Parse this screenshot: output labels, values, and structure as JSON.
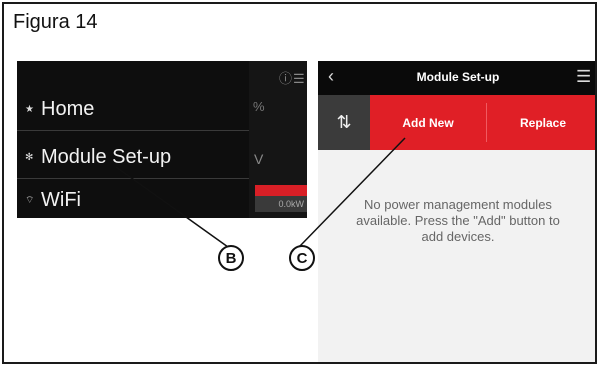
{
  "figure": {
    "title": "Figura 14"
  },
  "left_screen": {
    "menu": [
      {
        "icon": "home-icon",
        "glyph": "★",
        "label": "Home"
      },
      {
        "icon": "gear-icon",
        "glyph": "✻",
        "label": "Module Set-up"
      },
      {
        "icon": "wifi-icon",
        "glyph": "⌔",
        "label": "WiFi"
      }
    ],
    "background_values": {
      "percent": "%",
      "volt": "V",
      "power": "0.0kW"
    },
    "top_icons": "ⓘ☰"
  },
  "right_screen": {
    "header": {
      "back": "‹",
      "title": "Module Set-up",
      "menu": "☰"
    },
    "toolbar": {
      "icon": "⇅",
      "add_new": "Add New",
      "replace": "Replace"
    },
    "empty_message": "No power management modules available. Press the \"Add\" button to add devices."
  },
  "callouts": {
    "b": "B",
    "c": "C"
  },
  "colors": {
    "accent_red": "#e01f26",
    "dark_header": "#0a0a0a"
  }
}
